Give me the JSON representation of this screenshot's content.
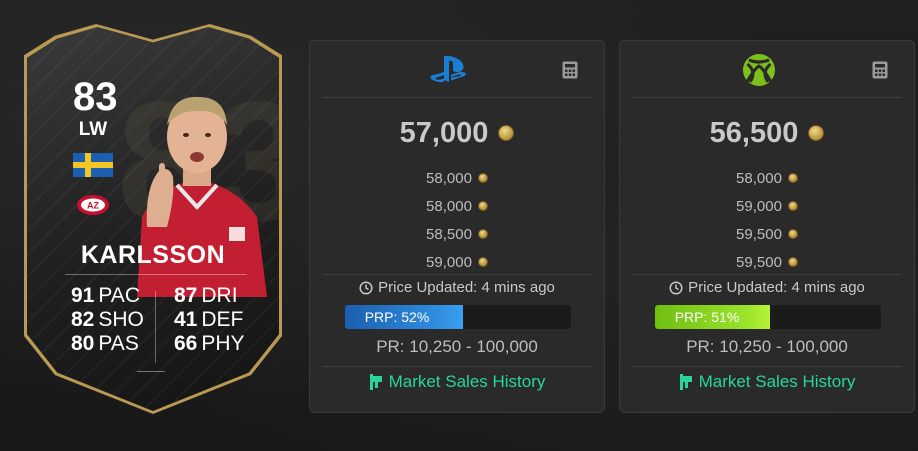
{
  "card": {
    "rating": "83",
    "position": "LW",
    "name": "KARLSSON",
    "watermark": "83",
    "nation_flag": "sweden-flag-icon",
    "club_badge": "az-alkmaar-badge-icon",
    "stats_left": [
      {
        "value": "91",
        "label": "PAC"
      },
      {
        "value": "82",
        "label": "SHO"
      },
      {
        "value": "80",
        "label": "PAS"
      }
    ],
    "stats_right": [
      {
        "value": "87",
        "label": "DRI"
      },
      {
        "value": "41",
        "label": "DEF"
      },
      {
        "value": "66",
        "label": "PHY"
      }
    ]
  },
  "platforms": [
    {
      "id": "playstation",
      "icon": "playstation-logo-icon",
      "main_price": "57,000",
      "recent_prices": [
        "58,000",
        "58,000",
        "58,500",
        "59,000"
      ],
      "updated": "Price Updated: 4 mins ago",
      "prp_label": "PRP: 52%",
      "prp_percent": 52,
      "prp_color": "#2f8ee0",
      "price_range": "PR: 10,250 - 100,000",
      "history_label": "Market Sales History"
    },
    {
      "id": "xbox",
      "icon": "xbox-logo-icon",
      "main_price": "56,500",
      "recent_prices": [
        "58,000",
        "59,000",
        "59,500",
        "59,500"
      ],
      "updated": "Price Updated: 4 mins ago",
      "prp_label": "PRP: 51%",
      "prp_percent": 51,
      "prp_color": "#9be32b",
      "price_range": "PR: 10,250 - 100,000",
      "history_label": "Market Sales History"
    }
  ],
  "colors": {
    "accent_green": "#29d69a",
    "card_gold": "#b99a53",
    "background": "#1c1c1c"
  }
}
